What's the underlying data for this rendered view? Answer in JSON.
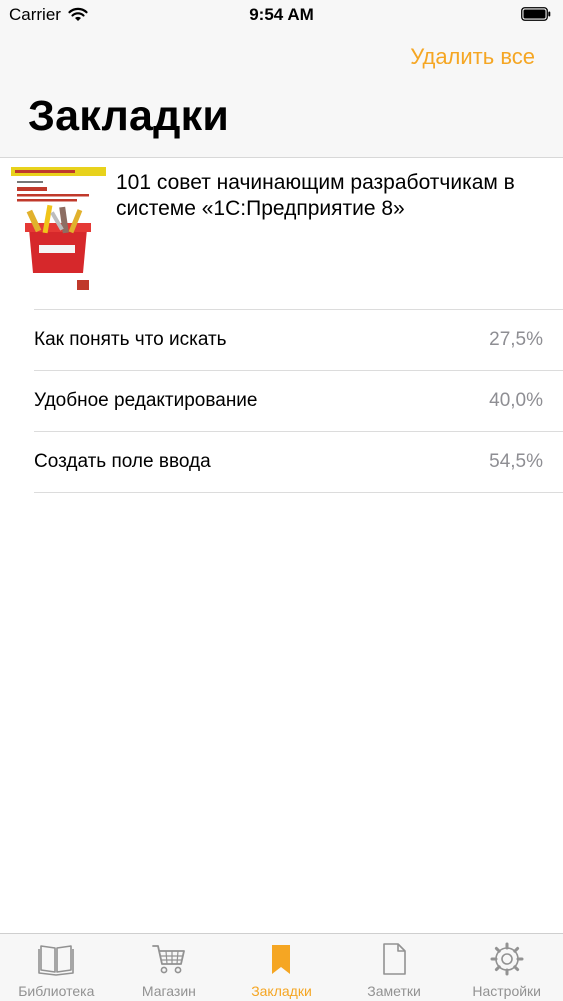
{
  "status_bar": {
    "carrier": "Carrier",
    "time": "9:54 AM"
  },
  "nav": {
    "delete_all": "Удалить все",
    "title": "Закладки"
  },
  "book": {
    "title": "101 совет начинающим разработчикам в системе «1С:Предприятие 8»"
  },
  "bookmarks": [
    {
      "label": "Как понять что искать",
      "percent": "27,5%"
    },
    {
      "label": "Удобное редактирование",
      "percent": "40,0%"
    },
    {
      "label": "Создать поле ввода",
      "percent": "54,5%"
    }
  ],
  "tabs": [
    {
      "label": "Библиотека",
      "icon": "book-icon",
      "active": false
    },
    {
      "label": "Магазин",
      "icon": "cart-icon",
      "active": false
    },
    {
      "label": "Закладки",
      "icon": "bookmark-icon",
      "active": true
    },
    {
      "label": "Заметки",
      "icon": "note-icon",
      "active": false
    },
    {
      "label": "Настройки",
      "icon": "gear-icon",
      "active": false
    }
  ],
  "colors": {
    "accent": "#f5a623",
    "inactive": "#929292",
    "percent": "#8e8e93",
    "header_bg": "#f7f7f7"
  }
}
